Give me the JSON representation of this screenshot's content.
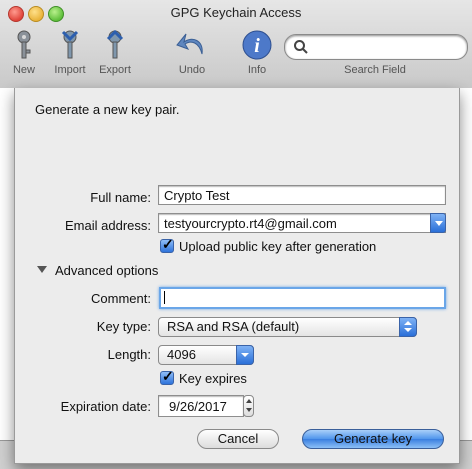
{
  "window": {
    "title": "GPG Keychain Access",
    "toolbar": [
      {
        "label": "New",
        "icon": "key-new-icon"
      },
      {
        "label": "Import",
        "icon": "key-import-icon"
      },
      {
        "label": "Export",
        "icon": "key-export-icon"
      },
      {
        "label": "Undo",
        "icon": "undo-icon"
      },
      {
        "label": "Info",
        "icon": "info-icon"
      }
    ],
    "search": {
      "label": "Search Field",
      "value": ""
    }
  },
  "sheet": {
    "heading": "Generate a new key pair.",
    "full_name": {
      "label": "Full name:",
      "value": "Crypto Test"
    },
    "email": {
      "label": "Email address:",
      "value": "testyourcrypto.rt4@gmail.com"
    },
    "upload": {
      "label": "Upload public key after generation",
      "checked": true
    },
    "advanced": {
      "label": "Advanced options",
      "expanded": true
    },
    "comment": {
      "label": "Comment:",
      "value": ""
    },
    "key_type": {
      "label": "Key type:",
      "value": "RSA and RSA (default)"
    },
    "length": {
      "label": "Length:",
      "value": "4096"
    },
    "expires": {
      "label": "Key expires",
      "checked": true
    },
    "expiration": {
      "label": "Expiration date:",
      "value": "9/26/2017"
    },
    "buttons": {
      "cancel": "Cancel",
      "generate": "Generate key"
    }
  },
  "colors": {
    "accent": "#3a7fe0",
    "focus_ring": "#6aa6e8"
  }
}
